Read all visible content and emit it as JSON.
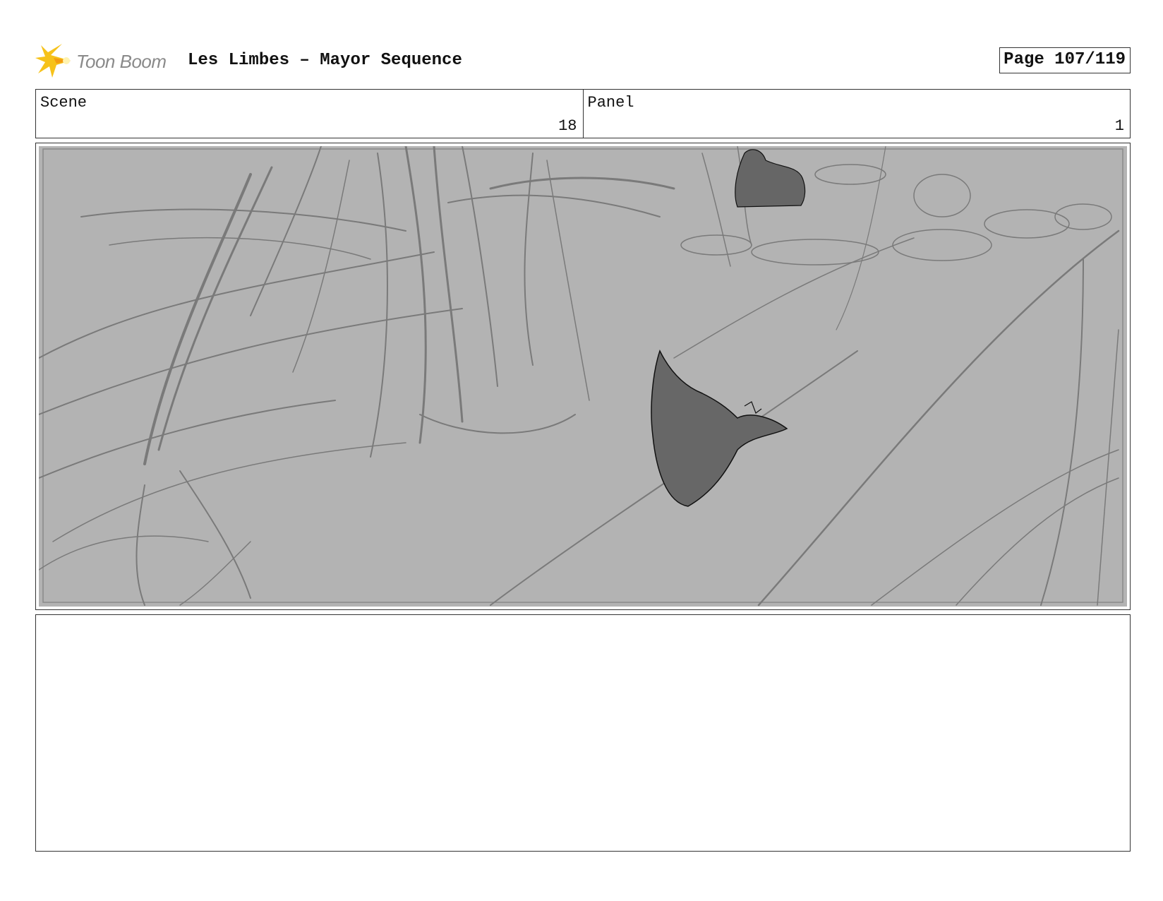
{
  "header": {
    "logo_icon": "toon-boom-star-logo",
    "logo_text": "Toon Boom",
    "title": "Les Limbes – Mayor Sequence",
    "page_label": "Page 107/119"
  },
  "info": {
    "scene_label": "Scene",
    "scene_value": "18",
    "panel_label": "Panel",
    "panel_value": "1"
  },
  "panel": {
    "image": "rough-sketch-forest-path-with-figures"
  },
  "notes": {
    "text": ""
  },
  "colors": {
    "sketch_background": "#b3b3b3",
    "sketch_lines": "#777777",
    "figure_fill": "#666666",
    "logo_yellow": "#f6c21a"
  }
}
